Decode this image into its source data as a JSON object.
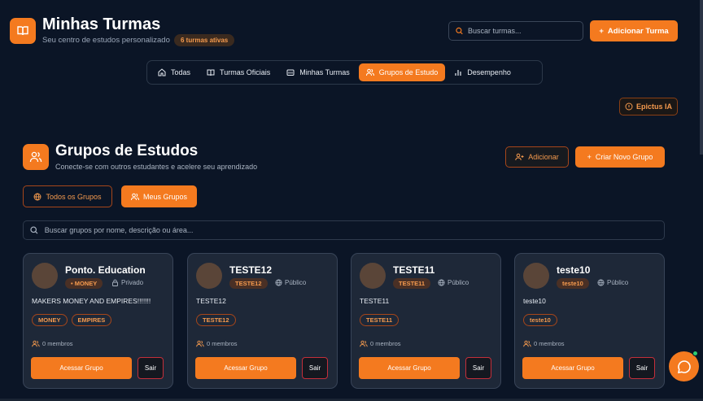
{
  "header": {
    "title": "Minhas Turmas",
    "subtitle": "Seu centro de estudos personalizado",
    "active_badge": "6 turmas ativas",
    "search_placeholder": "Buscar turmas...",
    "add_button": "Adicionar Turma"
  },
  "tabs": [
    {
      "label": "Todas",
      "icon": "home-icon",
      "active": false
    },
    {
      "label": "Turmas Oficiais",
      "icon": "book-icon",
      "active": false
    },
    {
      "label": "Minhas Turmas",
      "icon": "folder-icon",
      "active": false
    },
    {
      "label": "Grupos de Estudo",
      "icon": "users-icon",
      "active": true
    },
    {
      "label": "Desempenho",
      "icon": "bar-chart-icon",
      "active": false
    }
  ],
  "epictus_button": "Epictus IA",
  "section": {
    "title": "Grupos de Estudos",
    "subtitle": "Conecte-se com outros estudantes e acelere seu aprendizado",
    "add_button": "Adicionar",
    "create_button": "Criar Novo Grupo",
    "filter_all": "Todos os Grupos",
    "filter_mine": "Meus Grupos",
    "search_placeholder": "Buscar grupos por nome, descrição ou área..."
  },
  "cards": [
    {
      "name": "Ponto. Education",
      "category": "• MONEY",
      "visibility": "Privado",
      "visibility_icon": "lock-icon",
      "description": "MAKERS MONEY AND EMPIRES!!!!!!!",
      "tags": [
        "MONEY",
        "EMPIRES"
      ],
      "members": "0 membros",
      "access": "Acessar Grupo",
      "leave": "Sair"
    },
    {
      "name": "TESTE12",
      "category": "TESTE12",
      "visibility": "Público",
      "visibility_icon": "globe-icon",
      "description": "TESTE12",
      "tags": [
        "TESTE12"
      ],
      "members": "0 membros",
      "access": "Acessar Grupo",
      "leave": "Sair"
    },
    {
      "name": "TESTE11",
      "category": "TESTE11",
      "visibility": "Público",
      "visibility_icon": "globe-icon",
      "description": "TESTE11",
      "tags": [
        "TESTE11"
      ],
      "members": "0 membros",
      "access": "Acessar Grupo",
      "leave": "Sair"
    },
    {
      "name": "teste10",
      "category": "teste10",
      "visibility": "Público",
      "visibility_icon": "globe-icon",
      "description": "teste10",
      "tags": [
        "teste10"
      ],
      "members": "0 membros",
      "access": "Acessar Grupo",
      "leave": "Sair"
    }
  ],
  "colors": {
    "accent": "#f47a1f",
    "background": "#0b1526",
    "card": "#1e2838",
    "danger": "#c42f3a"
  }
}
